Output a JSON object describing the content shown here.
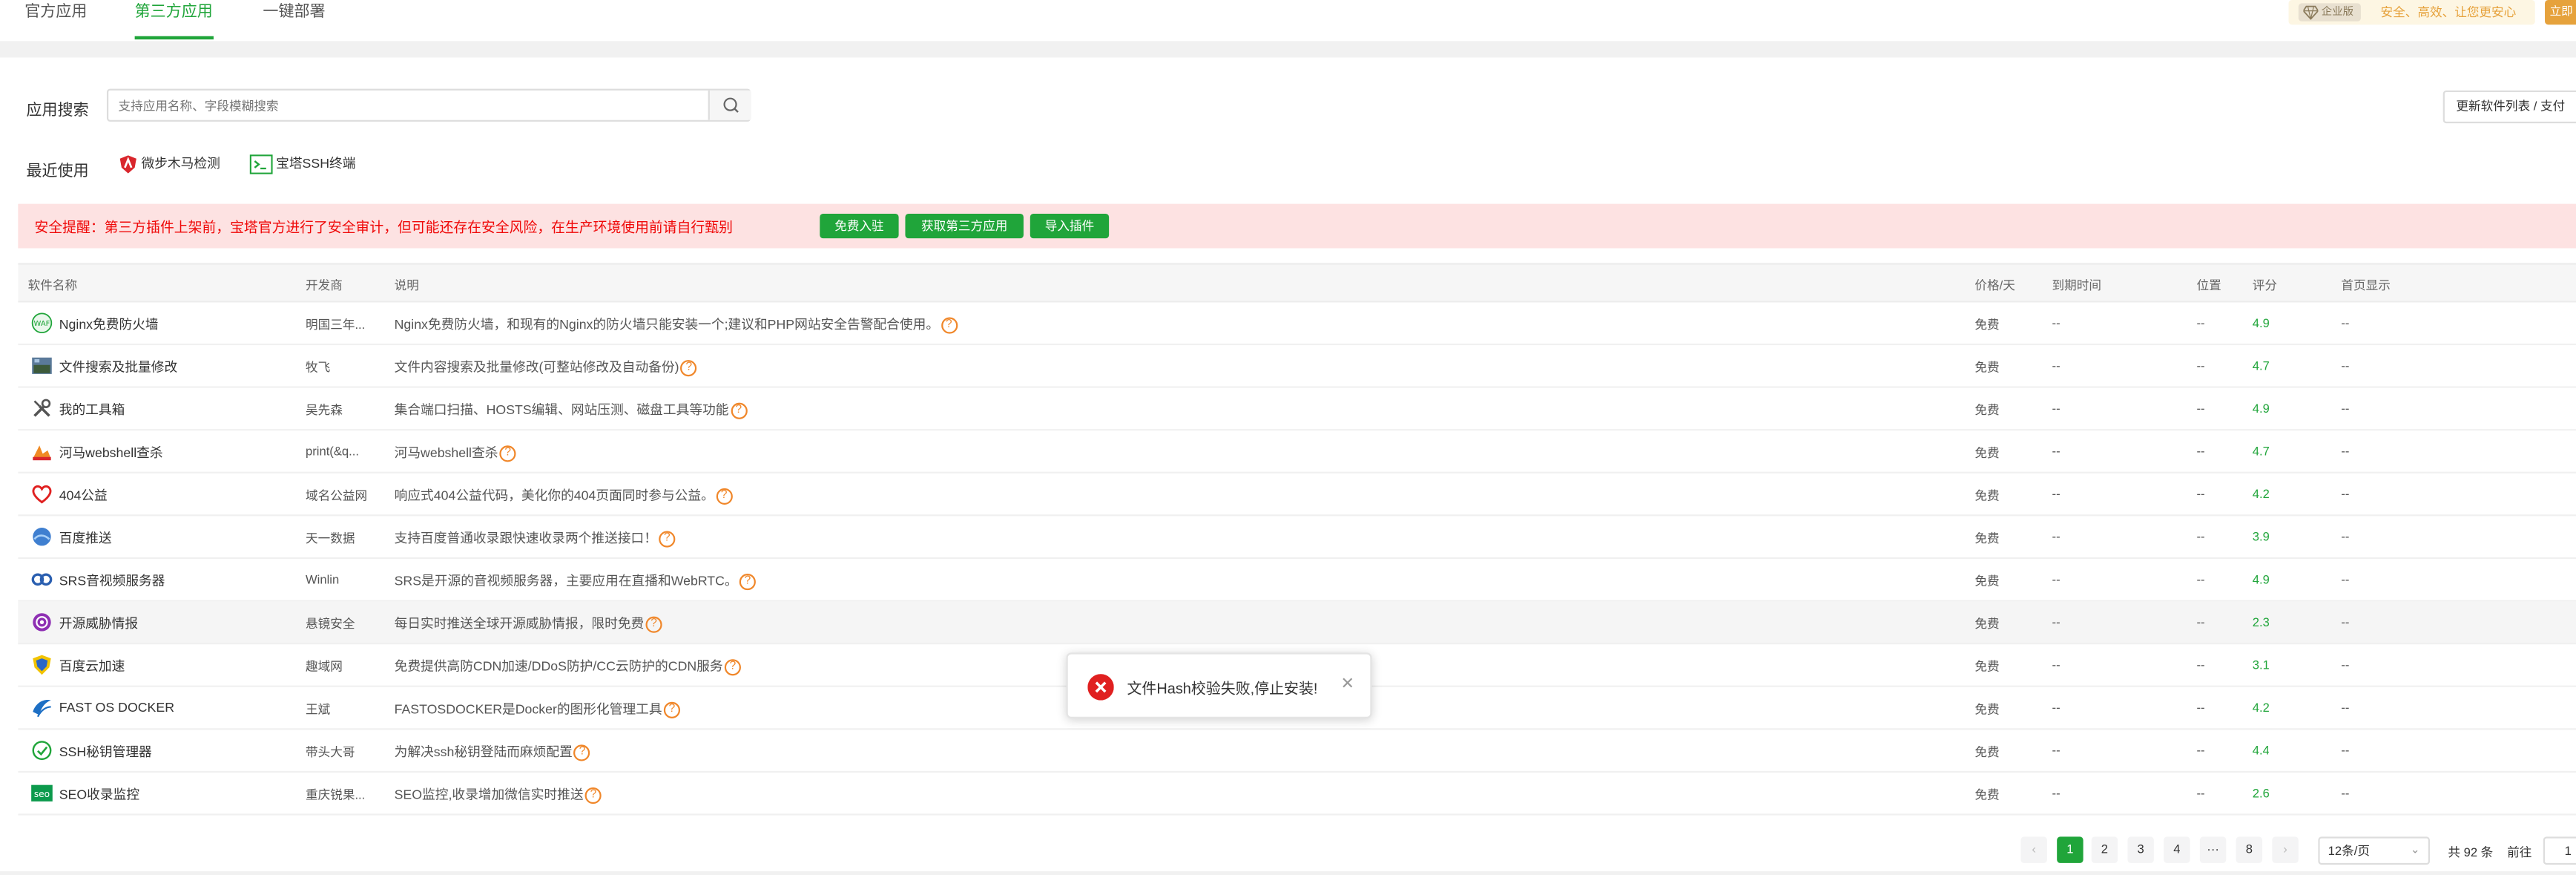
{
  "tabs": [
    {
      "label": "官方应用",
      "active": false
    },
    {
      "label": "第三方应用",
      "active": true
    },
    {
      "label": "一键部署",
      "active": false
    }
  ],
  "enterprise": {
    "badge": "企业版",
    "slogan": "安全、高效、让您更安心",
    "button": "立即"
  },
  "search": {
    "label": "应用搜索",
    "placeholder": "支持应用名称、字段模糊搜索",
    "update_button": "更新软件列表 / 支付"
  },
  "recent": {
    "label": "最近使用",
    "items": [
      {
        "label": "微步木马检测",
        "icon": "shield-icon"
      },
      {
        "label": "宝塔SSH终端",
        "icon": "terminal-icon"
      }
    ]
  },
  "alert": {
    "text": "安全提醒：第三方插件上架前，宝塔官方进行了安全审计，但可能还存在安全风险，在生产环境使用前请自行甄别",
    "buttons": [
      "免费入驻",
      "获取第三方应用",
      "导入插件"
    ]
  },
  "table": {
    "headers": [
      "软件名称",
      "开发商",
      "说明",
      "价格/天",
      "到期时间",
      "位置",
      "评分",
      "首页显示"
    ],
    "rows": [
      {
        "icon": "waf-icon",
        "name": "Nginx免费防火墙",
        "dev": "明国三年...",
        "desc": "Nginx免费防火墙，和现有的Nginx的防火墙只能安装一个;建议和PHP网站安全告警配合使用。",
        "price": "免费",
        "expire": "--",
        "pos": "--",
        "score": "4.9",
        "home": "--"
      },
      {
        "icon": "file-search-icon",
        "name": "文件搜索及批量修改",
        "dev": "牧飞",
        "desc": "文件内容搜索及批量修改(可整站修改及自动备份)",
        "price": "免费",
        "expire": "--",
        "pos": "--",
        "score": "4.7",
        "home": "--"
      },
      {
        "icon": "tools-icon",
        "name": "我的工具箱",
        "dev": "吴先森",
        "desc": "集合端口扫描、HOSTS编辑、网站压测、磁盘工具等功能",
        "price": "免费",
        "expire": "--",
        "pos": "--",
        "score": "4.9",
        "home": "--"
      },
      {
        "icon": "webshell-icon",
        "name": "河马webshell查杀",
        "dev": "print(&q...",
        "desc": "河马webshell查杀",
        "price": "免费",
        "expire": "--",
        "pos": "--",
        "score": "4.7",
        "home": "--"
      },
      {
        "icon": "heart-icon",
        "name": "404公益",
        "dev": "域名公益网",
        "desc": "响应式404公益代码，美化你的404页面同时参与公益。",
        "price": "免费",
        "expire": "--",
        "pos": "--",
        "score": "4.2",
        "home": "--"
      },
      {
        "icon": "baidu-push-icon",
        "name": "百度推送",
        "dev": "天一数据",
        "desc": "支持百度普通收录跟快速收录两个推送接口！",
        "price": "免费",
        "expire": "--",
        "pos": "--",
        "score": "3.9",
        "home": "--"
      },
      {
        "icon": "srs-icon",
        "name": "SRS音视频服务器",
        "dev": "Winlin",
        "desc": "SRS是开源的音视频服务器，主要应用在直播和WebRTC。",
        "price": "免费",
        "expire": "--",
        "pos": "--",
        "score": "4.9",
        "home": "--"
      },
      {
        "icon": "threat-intel-icon",
        "name": "开源威胁情报",
        "dev": "悬镜安全",
        "desc": "每日实时推送全球开源威胁情报，限时免费",
        "price": "免费",
        "expire": "--",
        "pos": "--",
        "score": "2.3",
        "home": "--"
      },
      {
        "icon": "cdn-shield-icon",
        "name": "百度云加速",
        "dev": "趣域网",
        "desc": "免费提供高防CDN加速/DDoS防护/CC云防护的CDN服务",
        "price": "免费",
        "expire": "--",
        "pos": "--",
        "score": "3.1",
        "home": "--"
      },
      {
        "icon": "docker-icon",
        "name": "FAST OS DOCKER",
        "dev": "王斌",
        "desc": "FASTOSDOCKER是Docker的图形化管理工具",
        "price": "免费",
        "expire": "--",
        "pos": "--",
        "score": "4.2",
        "home": "--"
      },
      {
        "icon": "ssh-key-icon",
        "name": "SSH秘钥管理器",
        "dev": "带头大哥",
        "desc": "为解决ssh秘钥登陆而麻烦配置",
        "price": "免费",
        "expire": "--",
        "pos": "--",
        "score": "4.4",
        "home": "--"
      },
      {
        "icon": "seo-icon",
        "name": "SEO收录监控",
        "dev": "重庆锐果...",
        "desc": "SEO监控,收录增加微信实时推送",
        "price": "免费",
        "expire": "--",
        "pos": "--",
        "score": "2.6",
        "home": "--"
      }
    ]
  },
  "pagination": {
    "pages": [
      "1",
      "2",
      "3",
      "4",
      "···",
      "8"
    ],
    "current": "1",
    "page_size": "12条/页",
    "total": "共 92 条",
    "goto_label": "前往",
    "goto_value": "1"
  },
  "toast": {
    "message": "文件Hash校验失败,停止安装!",
    "close": "✕"
  },
  "colors": {
    "accent": "#20a53a",
    "alert_text": "#ef0808",
    "alert_bg": "#fde2e2",
    "enterprise": "#e6a23c",
    "error": "#e02020"
  }
}
